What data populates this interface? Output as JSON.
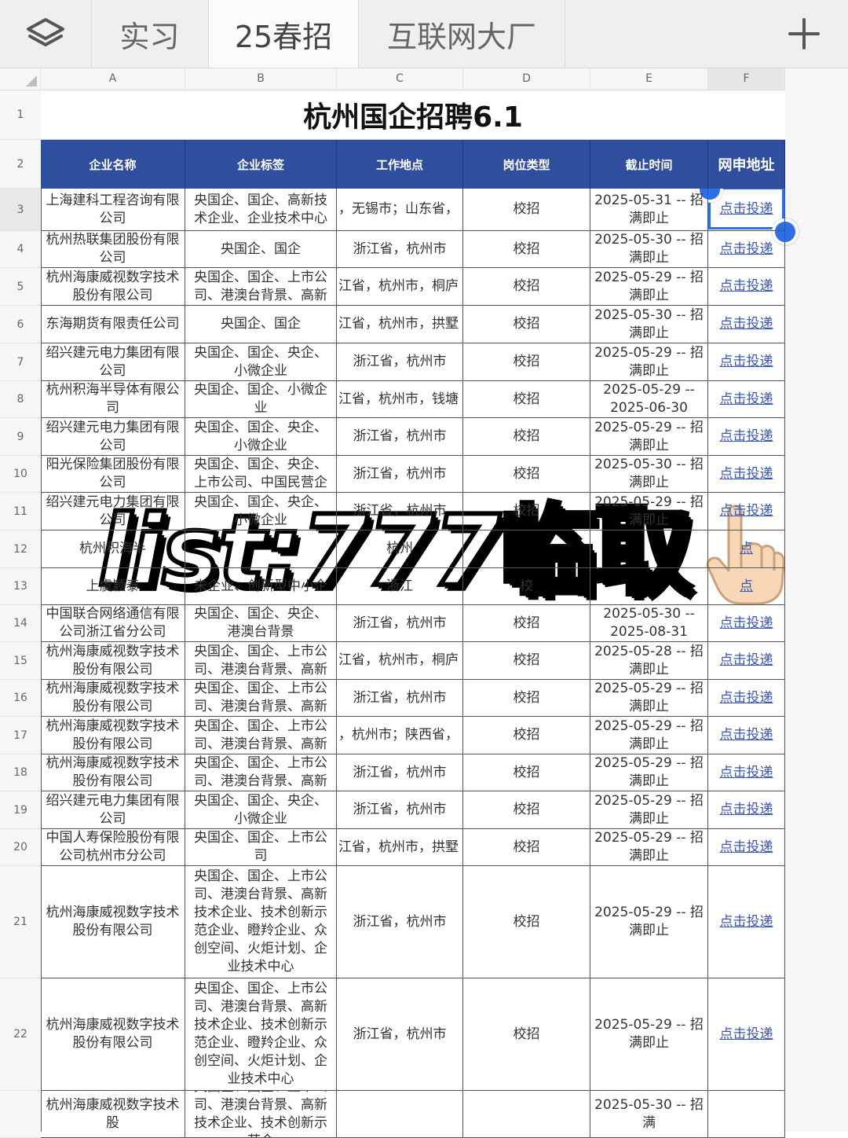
{
  "tabs": [
    {
      "label": "实习",
      "active": false
    },
    {
      "label": "25春招",
      "active": true
    },
    {
      "label": "互联网大厂",
      "active": false
    }
  ],
  "toolbar": {
    "layers_icon": "layers-icon",
    "add_icon": "plus-icon"
  },
  "columns": [
    "A",
    "B",
    "C",
    "D",
    "E",
    "F"
  ],
  "selected_column": "F",
  "selected_row": "3",
  "sheet": {
    "title": "杭州国企招聘6.1",
    "headers": [
      "企业名称",
      "企业标签",
      "工作地点",
      "岗位类型",
      "截止时间",
      "网申地址"
    ],
    "rows": [
      {
        "num": "3",
        "company": "上海建科工程咨询有限公司",
        "tags": "央国企、国企、高新技术企业、企业技术中心",
        "location": "，无锡市；山东省，",
        "type": "校招",
        "deadline": "2025-05-31 -- 招满即止",
        "link": "点击投递"
      },
      {
        "num": "4",
        "company": "杭州热联集团股份有限公司",
        "tags": "央国企、国企",
        "location": "浙江省，杭州市",
        "type": "校招",
        "deadline": "2025-05-30 -- 招满即止",
        "link": "点击投递"
      },
      {
        "num": "5",
        "company": "杭州海康威视数字技术股份有限公司",
        "tags": "央国企、国企、上市公司、港澳台背景、高新",
        "location": "江省，杭州市，桐庐",
        "type": "校招",
        "deadline": "2025-05-29 -- 招满即止",
        "link": "点击投递"
      },
      {
        "num": "6",
        "company": "东海期货有限责任公司",
        "tags": "央国企、国企",
        "location": "江省，杭州市，拱墅",
        "type": "校招",
        "deadline": "2025-05-30 -- 招满即止",
        "link": "点击投递"
      },
      {
        "num": "7",
        "company": "绍兴建元电力集团有限公司",
        "tags": "央国企、国企、央企、小微企业",
        "location": "浙江省，杭州市",
        "type": "校招",
        "deadline": "2025-05-29 -- 招满即止",
        "link": "点击投递"
      },
      {
        "num": "8",
        "company": "杭州积海半导体有限公司",
        "tags": "央国企、国企、小微企业",
        "location": "江省，杭州市，钱塘",
        "type": "校招",
        "deadline": "2025-05-29 -- 2025-06-30",
        "link": "点击投递"
      },
      {
        "num": "9",
        "company": "绍兴建元电力集团有限公司",
        "tags": "央国企、国企、央企、小微企业",
        "location": "浙江省，杭州市",
        "type": "校招",
        "deadline": "2025-05-29 -- 招满即止",
        "link": "点击投递"
      },
      {
        "num": "10",
        "company": "阳光保险集团股份有限公司",
        "tags": "央国企、国企、央企、上市公司、中国民营企",
        "location": "浙江省，杭州市",
        "type": "校招",
        "deadline": "2025-05-30 -- 招满即止",
        "link": "点击投递"
      },
      {
        "num": "11",
        "company": "绍兴建元电力集团有限公司",
        "tags": "央国企、国企、央企、小微企业",
        "location": "浙江省，杭州市",
        "type": "校招",
        "deadline": "2025-05-29 -- 招满即止",
        "link": "点击投递"
      },
      {
        "num": "12",
        "company": "杭州积海半",
        "tags": "",
        "location": "杭州",
        "type": "",
        "deadline": "",
        "link": "点"
      },
      {
        "num": "13",
        "company": "上虞颖泰",
        "tags": "未企业、创新型中小企",
        "location": "浙江",
        "type": "校",
        "deadline": "",
        "link": "点"
      },
      {
        "num": "14",
        "company": "中国联合网络通信有限公司浙江省分公司",
        "tags": "央国企、国企、央企、港澳台背景",
        "location": "浙江省，杭州市",
        "type": "校招",
        "deadline": "2025-05-30 -- 2025-08-31",
        "link": "点击投递"
      },
      {
        "num": "15",
        "company": "杭州海康威视数字技术股份有限公司",
        "tags": "央国企、国企、上市公司、港澳台背景、高新",
        "location": "江省，杭州市，桐庐",
        "type": "校招",
        "deadline": "2025-05-28 -- 招满即止",
        "link": "点击投递"
      },
      {
        "num": "16",
        "company": "杭州海康威视数字技术股份有限公司",
        "tags": "央国企、国企、上市公司、港澳台背景、高新",
        "location": "浙江省，杭州市",
        "type": "校招",
        "deadline": "2025-05-29 -- 招满即止",
        "link": "点击投递"
      },
      {
        "num": "17",
        "company": "杭州海康威视数字技术股份有限公司",
        "tags": "央国企、国企、上市公司、港澳台背景、高新",
        "location": "，杭州市；陕西省，",
        "type": "校招",
        "deadline": "2025-05-29 -- 招满即止",
        "link": "点击投递"
      },
      {
        "num": "18",
        "company": "杭州海康威视数字技术股份有限公司",
        "tags": "央国企、国企、上市公司、港澳台背景、高新",
        "location": "浙江省，杭州市",
        "type": "校招",
        "deadline": "2025-05-29 -- 招满即止",
        "link": "点击投递"
      },
      {
        "num": "19",
        "company": "绍兴建元电力集团有限公司",
        "tags": "央国企、国企、央企、小微企业",
        "location": "浙江省，杭州市",
        "type": "校招",
        "deadline": "2025-05-29 -- 招满即止",
        "link": "点击投递"
      },
      {
        "num": "20",
        "company": "中国人寿保险股份有限公司杭州市分公司",
        "tags": "央国企、国企、上市公司",
        "location": "江省，杭州市，拱墅",
        "type": "校招",
        "deadline": "2025-05-29 -- 招满即止",
        "link": "点击投递"
      },
      {
        "num": "21",
        "company": "杭州海康威视数字技术股份有限公司",
        "tags": "央国企、国企、上市公司、港澳台背景、高新技术企业、技术创新示范企业、瞪羚企业、众创空间、火炬计划、企业技术中心",
        "location": "浙江省，杭州市",
        "type": "校招",
        "deadline": "2025-05-29 -- 招满即止",
        "link": "点击投递"
      },
      {
        "num": "22",
        "company": "杭州海康威视数字技术股份有限公司",
        "tags": "央国企、国企、上市公司、港澳台背景、高新技术企业、技术创新示范企业、瞪羚企业、众创空间、火炬计划、企业技术中心",
        "location": "浙江省，杭州市",
        "type": "校招",
        "deadline": "2025-05-29 -- 招满即止",
        "link": "点击投递"
      },
      {
        "num": "",
        "company": "杭州海康威视数字技术股",
        "tags": "央国企、国企、上市公司、港澳台背景、高新技术企业、技术创新示范企",
        "location": "",
        "type": "",
        "deadline": "2025-05-30 -- 招满",
        "link": ""
      }
    ]
  },
  "overlay": {
    "text_latin": "list:777",
    "text_cjk": "临取",
    "pointer_icon": "pointing-hand-icon"
  },
  "colors": {
    "header_bg": "#2f4f9e",
    "link": "#3b57b6",
    "selection": "#2f6fe5"
  }
}
